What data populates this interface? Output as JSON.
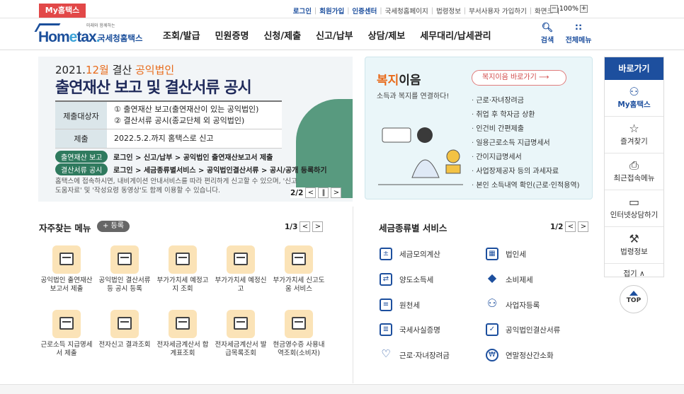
{
  "topbar": {
    "my_tab": "My홈택스",
    "links": [
      "로그인",
      "회원가입",
      "인증센터"
    ],
    "gray_links": [
      "국세청홈페이지",
      "법령정보",
      "부서사용자 가입하기",
      "화면크기"
    ],
    "zoom_minus": "−",
    "zoom_value": "100%",
    "zoom_plus": "+"
  },
  "header": {
    "logo_tagline": "미래와 함께하는",
    "logo_home": "Hom",
    "logo_e": "e",
    "logo_tax": "tax",
    "logo_dot": ".",
    "logo_nts": "국세청홈택스",
    "menu": [
      "조회/발급",
      "민원증명",
      "신청/제출",
      "신고/납부",
      "상담/제보",
      "세무대리/납세관리"
    ],
    "search_label": "검색",
    "all_menu_label": "전체메뉴"
  },
  "banner": {
    "year_prefix": "2021.",
    "month": "12월",
    "year_mid": " 결산 ",
    "public_corp": "공익법인",
    "title": "출연재산 보고 및 결산서류 공시",
    "row1_head": "제출대상자",
    "row1_line1": "① 출연재산 보고(출연재산이 있는 공익법인)",
    "row1_line2": "② 결산서류 공시(종교단체 외 공익법인)",
    "row2_head": "제출",
    "row2_value": "2022.5.2.까지 홈택스로 신고",
    "pill1": "출연재산 보고",
    "pill1_path": "로그인 > 신고/납부 > 공익법인 출연재산보고서 제출",
    "pill2": "결산서류 공시",
    "pill2_path": "로그인 > 세금종류별서비스 > 공익법인결산서류 > 공시/공개 등록하기",
    "note": "홈택스에 접속하시면, 내비게이션 안내서비스를 따라 편리하게 신고할 수 있으며, '신고도움자료' 및 '작성요령 동영상'도 함께 이용할 수 있습니다.",
    "page": "2/2"
  },
  "welfare": {
    "title_a": "복지",
    "title_b": "이음",
    "subtitle": "소득과 복지를 연결하다!",
    "go_button": "복지이음 바로가기  ⟶",
    "items": [
      "근로·자녀장려금",
      "취업 후 학자금 상환",
      "인건비 간편제출",
      "일용근로소득 지급명세서",
      "간이지급명세서",
      "사업장제공자 등의 과세자료",
      "본인 소득내역 확인(근로·인적용역)"
    ]
  },
  "quick": {
    "title": "바로가기",
    "items": [
      {
        "label": "My홈택스",
        "icon": "person-icon"
      },
      {
        "label": "즐겨찾기",
        "icon": "star-icon"
      },
      {
        "label": "최근접속메뉴",
        "icon": "recent-icon"
      },
      {
        "label": "인터넷상담하기",
        "icon": "monitor-icon"
      },
      {
        "label": "법령정보",
        "icon": "gavel-icon"
      }
    ],
    "fold": "접기 ∧",
    "top": "TOP"
  },
  "favorites": {
    "title": "자주찾는 메뉴",
    "register": "+ 등록",
    "page": "1/3",
    "items": [
      "공익법인 출연재산 보고서 제출",
      "공익법인 결산서류 등 공시 등록",
      "부가가치세 예정고지 조회",
      "부가가치세 예정신고",
      "부가가치세 신고도움 서비스",
      "근로소득 지급명세서 제출",
      "전자신고 결과조회",
      "전자세금계산서 합계표조회",
      "전자세금계산서 발급목록조회",
      "현금영수증 사용내역조회(소비자)"
    ]
  },
  "tax_services": {
    "title": "세금종류별 서비스",
    "page": "1/2",
    "items": [
      {
        "label": "세금모의계산",
        "icon": "calculator-icon"
      },
      {
        "label": "법인세",
        "icon": "building-icon"
      },
      {
        "label": "양도소득세",
        "icon": "transfer-icon"
      },
      {
        "label": "소비제세",
        "icon": "diamond-icon"
      },
      {
        "label": "원천세",
        "icon": "document-icon"
      },
      {
        "label": "사업자등록",
        "icon": "person-icon"
      },
      {
        "label": "국세사실증명",
        "icon": "certificate-icon"
      },
      {
        "label": "공익법인결산서류",
        "icon": "checklist-icon"
      },
      {
        "label": "근로·자녀장려금",
        "icon": "heart-icon"
      },
      {
        "label": "연말정산간소화",
        "icon": "coin-icon"
      }
    ]
  }
}
